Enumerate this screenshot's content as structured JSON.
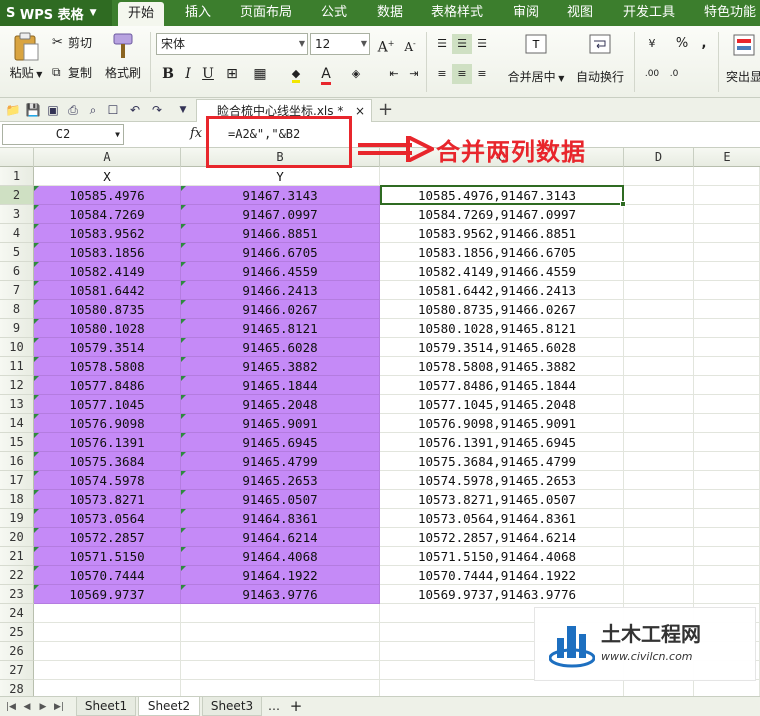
{
  "app": {
    "logo": "S",
    "name": "WPS 表格"
  },
  "menu": [
    "开始",
    "插入",
    "页面布局",
    "公式",
    "数据",
    "表格样式",
    "审阅",
    "视图",
    "开发工具",
    "特色功能"
  ],
  "ribbon": {
    "paste": "粘贴",
    "cut": "剪切",
    "copy": "复制",
    "format_painter": "格式刷",
    "font_name": "宋体",
    "font_size": "12",
    "bold": "B",
    "italic": "I",
    "underline": "U",
    "merge_center": "合并居中",
    "wrap_text": "自动换行",
    "percent": "%",
    "comma": ",",
    "highlight": "突出显"
  },
  "doc_tab": {
    "title": "睑合梳中心线坐标.xls *"
  },
  "formula_bar": {
    "cell_ref": "C2",
    "fx": "fx",
    "formula": "=A2&\",\"&B2"
  },
  "annotation": "合并两列数据",
  "columns": [
    "A",
    "B",
    "C",
    "D",
    "E"
  ],
  "header_row": {
    "a": "X",
    "b": "Y"
  },
  "rows": [
    {
      "n": "2",
      "a": "10585.4976",
      "b": "91467.3143",
      "c": "10585.4976,91467.3143"
    },
    {
      "n": "3",
      "a": "10584.7269",
      "b": "91467.0997",
      "c": "10584.7269,91467.0997"
    },
    {
      "n": "4",
      "a": "10583.9562",
      "b": "91466.8851",
      "c": "10583.9562,91466.8851"
    },
    {
      "n": "5",
      "a": "10583.1856",
      "b": "91466.6705",
      "c": "10583.1856,91466.6705"
    },
    {
      "n": "6",
      "a": "10582.4149",
      "b": "91466.4559",
      "c": "10582.4149,91466.4559"
    },
    {
      "n": "7",
      "a": "10581.6442",
      "b": "91466.2413",
      "c": "10581.6442,91466.2413"
    },
    {
      "n": "8",
      "a": "10580.8735",
      "b": "91466.0267",
      "c": "10580.8735,91466.0267"
    },
    {
      "n": "9",
      "a": "10580.1028",
      "b": "91465.8121",
      "c": "10580.1028,91465.8121"
    },
    {
      "n": "10",
      "a": "10579.3514",
      "b": "91465.6028",
      "c": "10579.3514,91465.6028"
    },
    {
      "n": "11",
      "a": "10578.5808",
      "b": "91465.3882",
      "c": "10578.5808,91465.3882"
    },
    {
      "n": "12",
      "a": "10577.8486",
      "b": "91465.1844",
      "c": "10577.8486,91465.1844"
    },
    {
      "n": "13",
      "a": "10577.1045",
      "b": "91465.2048",
      "c": "10577.1045,91465.2048"
    },
    {
      "n": "14",
      "a": "10576.9098",
      "b": "91465.9091",
      "c": "10576.9098,91465.9091"
    },
    {
      "n": "15",
      "a": "10576.1391",
      "b": "91465.6945",
      "c": "10576.1391,91465.6945"
    },
    {
      "n": "16",
      "a": "10575.3684",
      "b": "91465.4799",
      "c": "10575.3684,91465.4799"
    },
    {
      "n": "17",
      "a": "10574.5978",
      "b": "91465.2653",
      "c": "10574.5978,91465.2653"
    },
    {
      "n": "18",
      "a": "10573.8271",
      "b": "91465.0507",
      "c": "10573.8271,91465.0507"
    },
    {
      "n": "19",
      "a": "10573.0564",
      "b": "91464.8361",
      "c": "10573.0564,91464.8361"
    },
    {
      "n": "20",
      "a": "10572.2857",
      "b": "91464.6214",
      "c": "10572.2857,91464.6214"
    },
    {
      "n": "21",
      "a": "10571.5150",
      "b": "91464.4068",
      "c": "10571.5150,91464.4068"
    },
    {
      "n": "22",
      "a": "10570.7444",
      "b": "91464.1922",
      "c": "10570.7444,91464.1922"
    },
    {
      "n": "23",
      "a": "10569.9737",
      "b": "91463.9776",
      "c": "10569.9737,91463.9776"
    }
  ],
  "empty_rows": [
    "24",
    "25",
    "26",
    "27",
    "28"
  ],
  "sheets": [
    "Sheet1",
    "Sheet2",
    "Sheet3"
  ],
  "sheet_more": "…",
  "watermark": {
    "title": "土木工程网",
    "url": "www.civilcn.com"
  },
  "colors": {
    "menubar": "#3c7e2d",
    "purple_fill": "#c58af7",
    "annotation_red": "#e8262c",
    "selection": "#2f6b22"
  }
}
